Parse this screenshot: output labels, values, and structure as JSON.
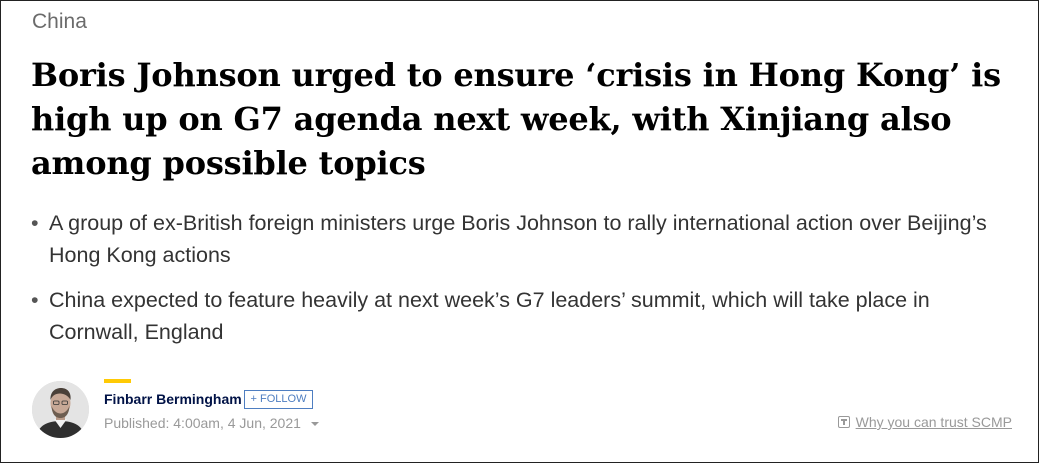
{
  "article": {
    "section": "China",
    "headline": "Boris Johnson urged to ensure ‘crisis in Hong Kong’ is high up on G7 agenda next week, with Xinjiang also among possible topics",
    "summary": [
      "A group of ex-British foreign ministers urge Boris Johnson to rally international action over Beijing’s Hong Kong actions",
      "China expected to feature heavily at next week’s G7 leaders’ summit, which will take place in Cornwall, England"
    ],
    "bullet_glyph": "•"
  },
  "author": {
    "name": "Finbarr Bermingham",
    "follow_label": "+ FOLLOW",
    "published": "Published: 4:00am, 4 Jun, 2021"
  },
  "trust": {
    "label": "Why you can trust SCMP"
  },
  "colors": {
    "accent": "#ffca05",
    "author_name": "#001246",
    "follow": "#4e7ec1"
  }
}
